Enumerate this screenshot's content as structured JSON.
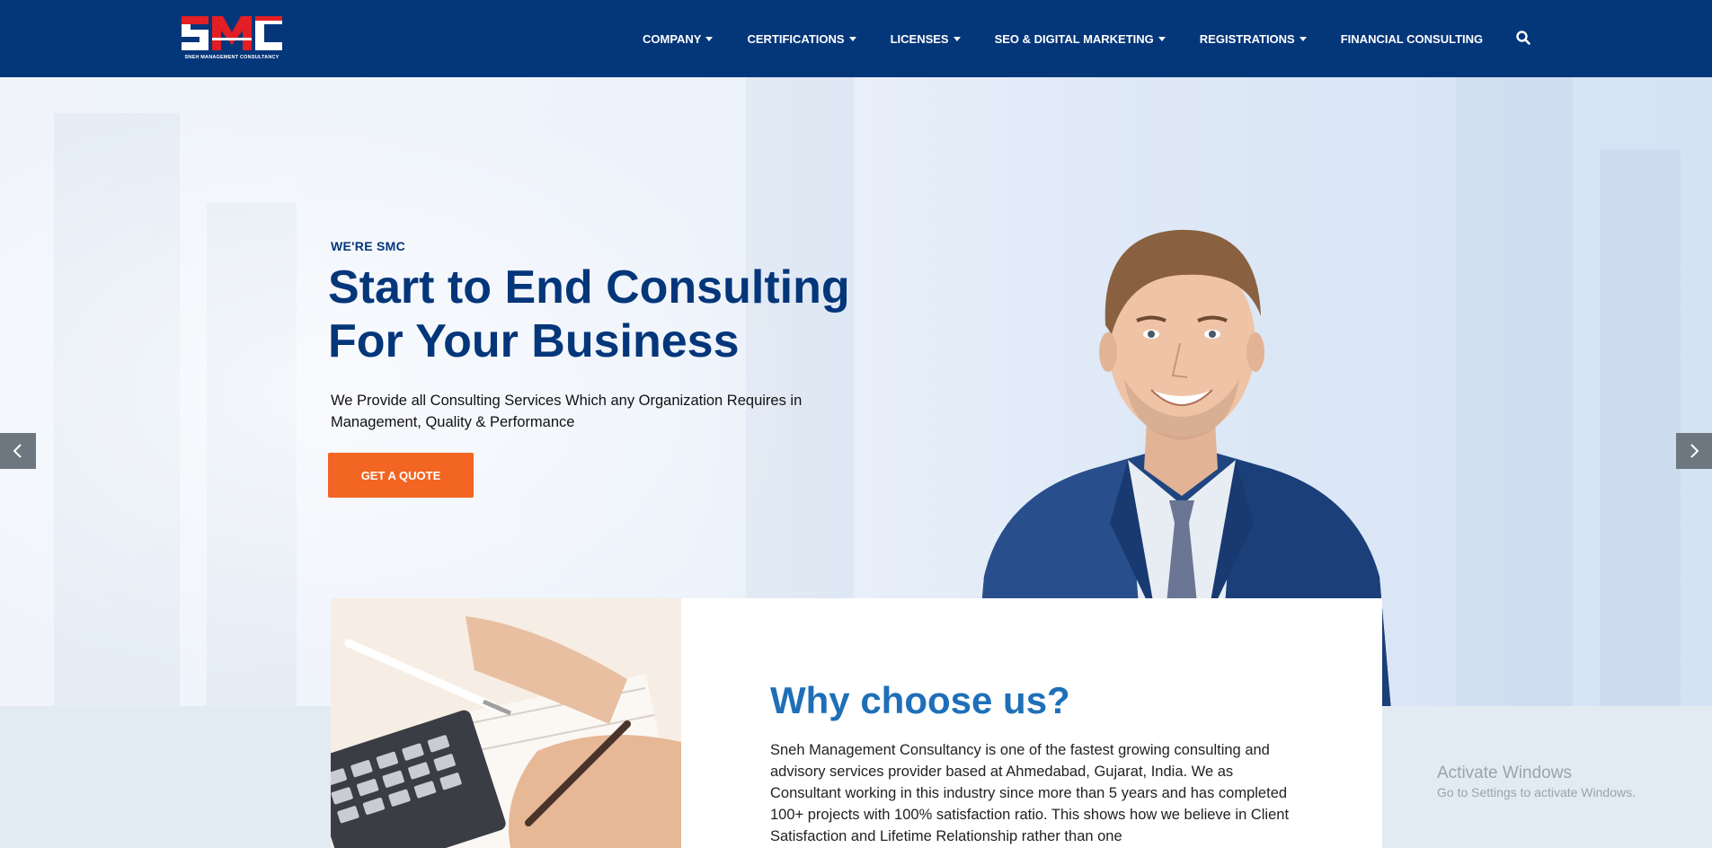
{
  "logo": {
    "text": "SMC",
    "subtitle": "SNEH MANAGEMENT CONSULTANCY"
  },
  "nav": {
    "items": [
      {
        "label": "COMPANY",
        "has_dropdown": true
      },
      {
        "label": "CERTIFICATIONS",
        "has_dropdown": true
      },
      {
        "label": "LICENSES",
        "has_dropdown": true
      },
      {
        "label": "SEO & DIGITAL MARKETING",
        "has_dropdown": true
      },
      {
        "label": "REGISTRATIONS",
        "has_dropdown": true
      },
      {
        "label": "FINANCIAL CONSULTING",
        "has_dropdown": false
      }
    ],
    "search_icon": "search-icon"
  },
  "hero": {
    "eyebrow": "WE'RE SMC",
    "title_line1": "Start to End Consulting",
    "title_line2": "For Your Business",
    "subtitle": "We Provide all Consulting Services Which any Organization Requires in Management, Quality & Performance",
    "cta_label": "GET A QUOTE",
    "prev_icon": "chevron-left-icon",
    "next_icon": "chevron-right-icon"
  },
  "why": {
    "title": "Why choose us?",
    "text": "Sneh Management Consultancy is one of the fastest growing consulting and advisory services provider based at Ahmedabad, Gujarat, India. We as Consultant working in this industry since more than 5 years and has completed 100+ projects with 100% satisfaction ratio. This shows how we believe in Client Satisfaction and Lifetime Relationship rather than one"
  },
  "watermark": {
    "line1": "Activate Windows",
    "line2": "Go to Settings to activate Windows."
  },
  "colors": {
    "header_bg": "#04367a",
    "accent_orange": "#f26522",
    "title_blue": "#04367a",
    "why_title_blue": "#1e6fb8",
    "logo_red": "#e31e24"
  }
}
